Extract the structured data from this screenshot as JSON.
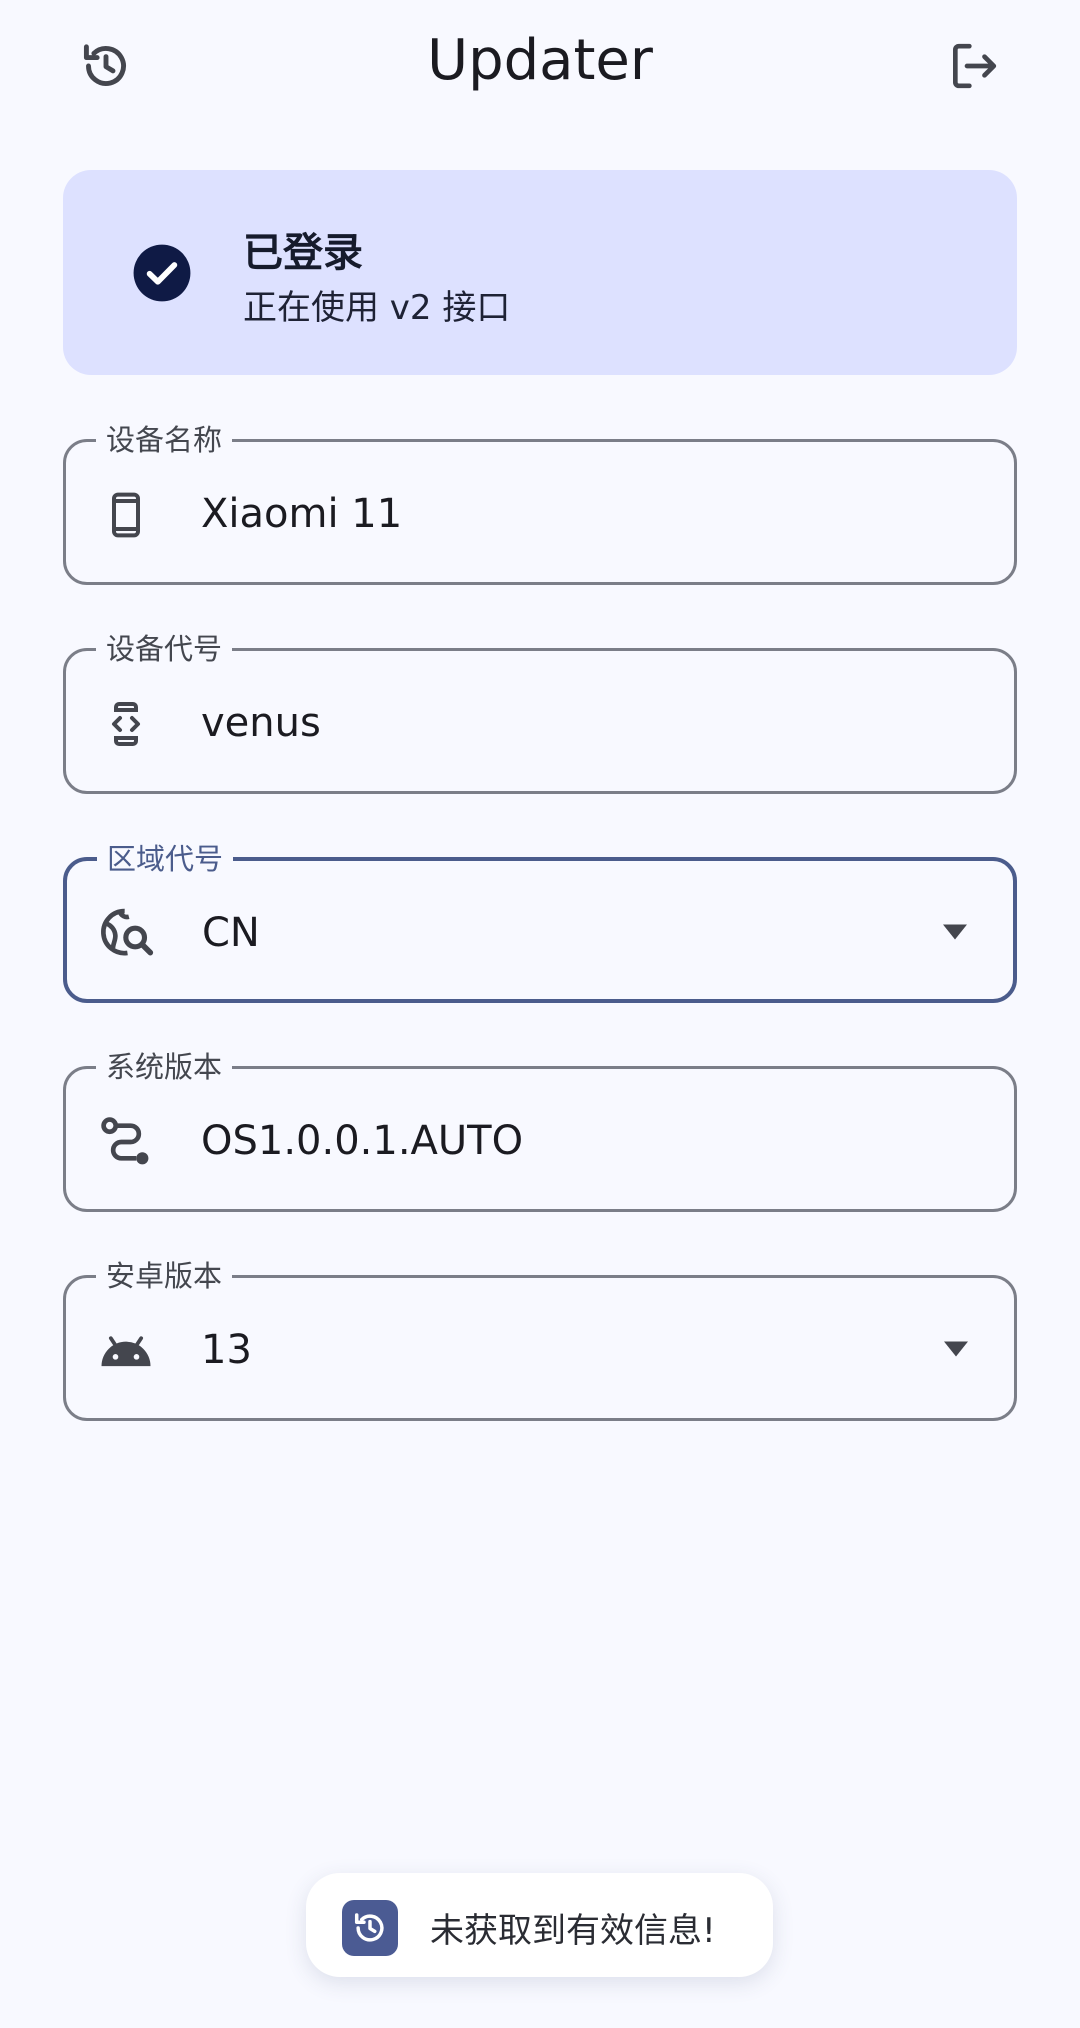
{
  "app": {
    "title": "Updater"
  },
  "login": {
    "status": "已登录",
    "subtitle": "正在使用 v2 接口"
  },
  "fields": [
    {
      "label": "设备名称",
      "value": "Xiaomi 11",
      "icon": "smartphone-icon"
    },
    {
      "label": "设备代号",
      "value": "venus",
      "icon": "developer-mode-icon"
    },
    {
      "label": "区域代号",
      "value": "CN",
      "icon": "travel-explore-icon",
      "dropdown": true,
      "focused": true
    },
    {
      "label": "系统版本",
      "value": "OS1.0.0.1.AUTO",
      "icon": "route-icon"
    },
    {
      "label": "安卓版本",
      "value": "13",
      "icon": "android-icon",
      "dropdown": true
    }
  ],
  "toast": {
    "message": "未获取到有效信息!",
    "icon": "history-icon"
  },
  "colors": {
    "background": "#f8f9ff",
    "card": "#dde1ff",
    "accent": "#4b5c8c",
    "outline": "#7b7e88",
    "check": "#0f1a45"
  }
}
